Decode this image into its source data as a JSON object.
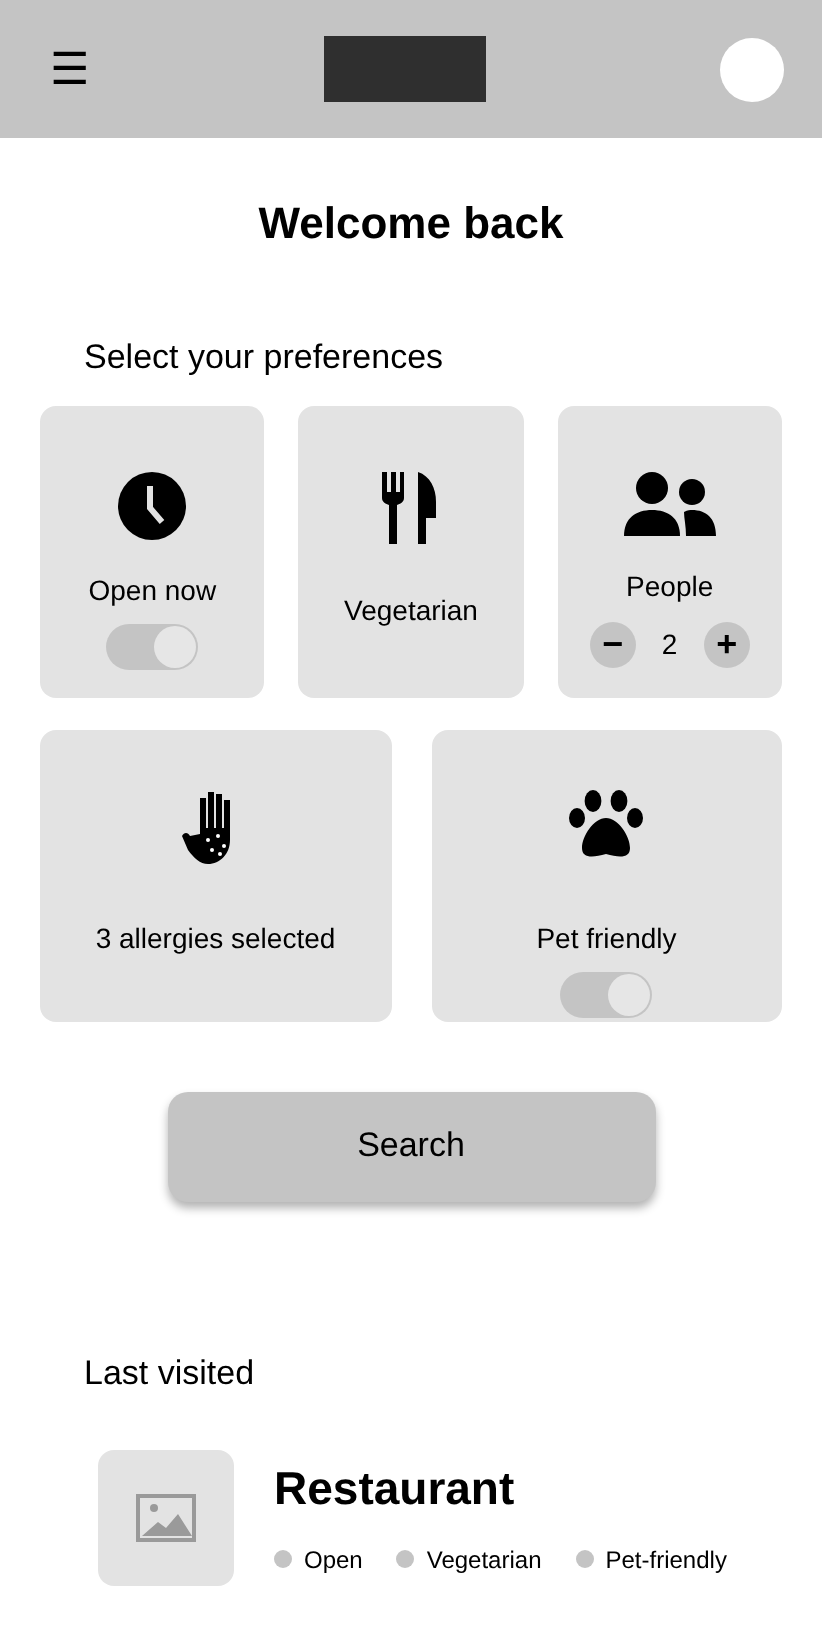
{
  "header": {
    "menu_icon": "☰"
  },
  "title": "Welcome back",
  "preferences": {
    "heading": "Select your preferences",
    "cards": [
      {
        "kind": "toggle",
        "label": "Open now",
        "on": true
      },
      {
        "kind": "plain",
        "label": "Vegetarian"
      },
      {
        "kind": "stepper",
        "label": "People",
        "value": "2",
        "minus": "−",
        "plus": "+"
      },
      {
        "kind": "plain",
        "label": "3 allergies selected"
      },
      {
        "kind": "toggle",
        "label": "Pet friendly",
        "on": true
      }
    ]
  },
  "search_button": "Search",
  "last_visited": {
    "heading": "Last visited",
    "items": [
      {
        "name": "Restaurant",
        "tags": [
          "Open",
          "Vegetarian",
          "Pet-friendly"
        ]
      }
    ]
  }
}
